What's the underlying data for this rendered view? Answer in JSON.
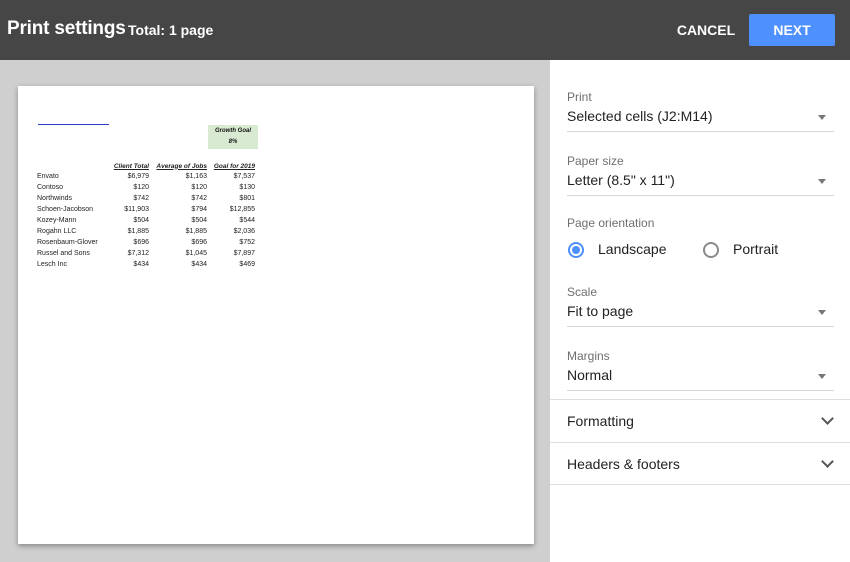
{
  "header": {
    "title": "Print settings",
    "total": "Total: 1 page",
    "cancel_label": "CANCEL",
    "next_label": "NEXT"
  },
  "preview": {
    "growth_goal_label": "Growth Goal",
    "growth_goal_value": "8%",
    "columns": [
      "Client Total",
      "Average of Jobs",
      "Goal for 2019"
    ],
    "rows": [
      {
        "name": "Envato",
        "total": "$6,979",
        "avg": "$1,163",
        "goal": "$7,537"
      },
      {
        "name": "Contoso",
        "total": "$120",
        "avg": "$120",
        "goal": "$130"
      },
      {
        "name": "Northwinds",
        "total": "$742",
        "avg": "$742",
        "goal": "$801"
      },
      {
        "name": "Schoen-Jacobson",
        "total": "$11,903",
        "avg": "$794",
        "goal": "$12,855"
      },
      {
        "name": "Kozey-Mann",
        "total": "$504",
        "avg": "$504",
        "goal": "$544"
      },
      {
        "name": "Rogahn LLC",
        "total": "$1,885",
        "avg": "$1,885",
        "goal": "$2,036"
      },
      {
        "name": "Rosenbaum-Glover",
        "total": "$696",
        "avg": "$696",
        "goal": "$752"
      },
      {
        "name": "Russel and Sons",
        "total": "$7,312",
        "avg": "$1,045",
        "goal": "$7,897"
      },
      {
        "name": "Lesch Inc",
        "total": "$434",
        "avg": "$434",
        "goal": "$469"
      }
    ]
  },
  "settings": {
    "print": {
      "label": "Print",
      "value": "Selected cells (J2:M14)"
    },
    "paper_size": {
      "label": "Paper size",
      "value": "Letter (8.5\" x 11\")"
    },
    "orientation": {
      "label": "Page orientation",
      "landscape": "Landscape",
      "portrait": "Portrait",
      "selected": "Landscape"
    },
    "scale": {
      "label": "Scale",
      "value": "Fit to page"
    },
    "margins": {
      "label": "Margins",
      "value": "Normal"
    },
    "formatting": "Formatting",
    "headers_footers": "Headers & footers"
  },
  "colors": {
    "accent": "#4d90fe",
    "topbar": "#464646",
    "preview_bg": "#cfcfcf"
  }
}
